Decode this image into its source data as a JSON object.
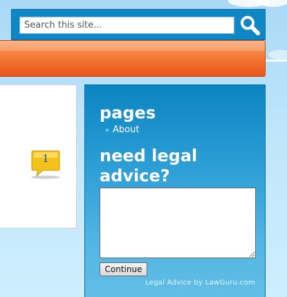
{
  "search": {
    "placeholder": "Search this site..."
  },
  "icons": {
    "search_button": "magnifier-icon",
    "comment_badge": "speech-bubble-icon"
  },
  "colors": {
    "sidebar_blue": "#0b84c2",
    "nav_orange": "#f47a36",
    "badge_yellow": "#f5c21b"
  },
  "post": {
    "comment_count": "1"
  },
  "sidebar": {
    "pages_title": "pages",
    "pages": [
      {
        "label": "About"
      }
    ],
    "legal_title": "need legal advice?",
    "textarea_value": "",
    "continue_label": "Continue",
    "powered_by": "Legal Advice by LawGuru.com"
  }
}
